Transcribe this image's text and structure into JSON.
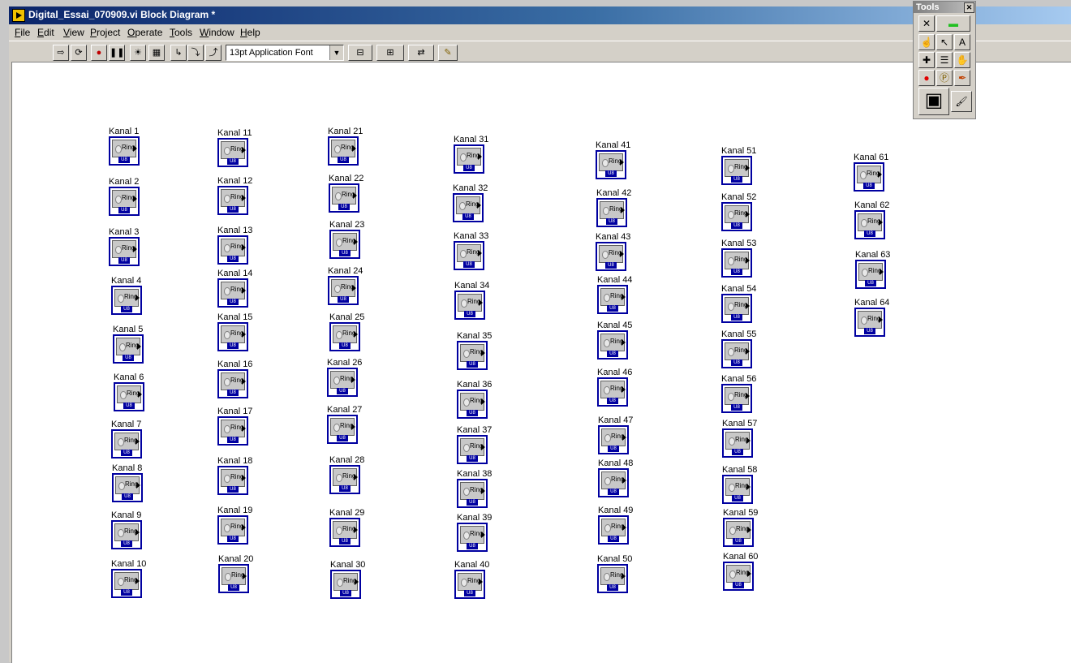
{
  "window": {
    "title": "Digital_Essai_070909.vi Block Diagram *",
    "menu": [
      "File",
      "Edit",
      "View",
      "Project",
      "Operate",
      "Tools",
      "Window",
      "Help"
    ]
  },
  "toolbar": {
    "font_select_value": "13pt Application Font",
    "buttons": [
      {
        "name": "run-arrow-icon",
        "glyph": "⇨"
      },
      {
        "name": "run-continuously-icon",
        "glyph": "⟳"
      },
      {
        "name": "abort-icon",
        "glyph": "●"
      },
      {
        "name": "pause-icon",
        "glyph": "❚❚"
      },
      {
        "name": "highlight-execution-icon",
        "glyph": "☀"
      },
      {
        "name": "retain-wire-values-icon",
        "glyph": "▦"
      },
      {
        "name": "step-into-icon",
        "glyph": "↳"
      },
      {
        "name": "step-over-icon",
        "glyph": "⤵"
      },
      {
        "name": "step-out-icon",
        "glyph": "⤴"
      },
      {
        "name": "align-objects-icon",
        "glyph": "⊟"
      },
      {
        "name": "distribute-objects-icon",
        "glyph": "⊞"
      },
      {
        "name": "reorder-icon",
        "glyph": "⇄"
      },
      {
        "name": "clean-up-diagram-icon",
        "glyph": "✎"
      }
    ]
  },
  "diagram": {
    "terminal_face_text": "Ring",
    "terminal_type_text": "U8",
    "nodes": [
      {
        "label": "Kanal 1"
      },
      {
        "label": "Kanal 2"
      },
      {
        "label": "Kanal 3"
      },
      {
        "label": "Kanal 4"
      },
      {
        "label": "Kanal 5"
      },
      {
        "label": "Kanal 6"
      },
      {
        "label": "Kanal 7"
      },
      {
        "label": "Kanal 8"
      },
      {
        "label": "Kanal 9"
      },
      {
        "label": "Kanal 10"
      },
      {
        "label": "Kanal 11"
      },
      {
        "label": "Kanal 12"
      },
      {
        "label": "Kanal 13"
      },
      {
        "label": "Kanal 14"
      },
      {
        "label": "Kanal 15"
      },
      {
        "label": "Kanal 16"
      },
      {
        "label": "Kanal 17"
      },
      {
        "label": "Kanal 18"
      },
      {
        "label": "Kanal 19"
      },
      {
        "label": "Kanal 20"
      },
      {
        "label": "Kanal 21"
      },
      {
        "label": "Kanal 22"
      },
      {
        "label": "Kanal 23"
      },
      {
        "label": "Kanal 24"
      },
      {
        "label": "Kanal 25"
      },
      {
        "label": "Kanal 26"
      },
      {
        "label": "Kanal 27"
      },
      {
        "label": "Kanal 28"
      },
      {
        "label": "Kanal 29"
      },
      {
        "label": "Kanal 30"
      },
      {
        "label": "Kanal 31"
      },
      {
        "label": "Kanal 32"
      },
      {
        "label": "Kanal 33"
      },
      {
        "label": "Kanal 34"
      },
      {
        "label": "Kanal 35"
      },
      {
        "label": "Kanal 36"
      },
      {
        "label": "Kanal 37"
      },
      {
        "label": "Kanal 38"
      },
      {
        "label": "Kanal 39"
      },
      {
        "label": "Kanal 40"
      },
      {
        "label": "Kanal 41"
      },
      {
        "label": "Kanal 42"
      },
      {
        "label": "Kanal 43"
      },
      {
        "label": "Kanal 44"
      },
      {
        "label": "Kanal 45"
      },
      {
        "label": "Kanal 46"
      },
      {
        "label": "Kanal 47"
      },
      {
        "label": "Kanal 48"
      },
      {
        "label": "Kanal 49"
      },
      {
        "label": "Kanal 50"
      },
      {
        "label": "Kanal 51"
      },
      {
        "label": "Kanal 52"
      },
      {
        "label": "Kanal 53"
      },
      {
        "label": "Kanal 54"
      },
      {
        "label": "Kanal 55"
      },
      {
        "label": "Kanal 56"
      },
      {
        "label": "Kanal 57"
      },
      {
        "label": "Kanal 58"
      },
      {
        "label": "Kanal 59"
      },
      {
        "label": "Kanal 60"
      },
      {
        "label": "Kanal 61"
      },
      {
        "label": "Kanal 62"
      },
      {
        "label": "Kanal 63"
      },
      {
        "label": "Kanal 64"
      }
    ]
  },
  "tools_palette": {
    "title": "Tools",
    "close_glyph": "✕",
    "tools": [
      {
        "name": "automatic-tool-selection-icon",
        "glyph": "✕"
      },
      {
        "name": "automatic-tool-indicator-icon",
        "glyph": "▬"
      },
      {
        "name": "operate-value-tool-icon",
        "glyph": "☝"
      },
      {
        "name": "position-size-select-tool-icon",
        "glyph": "↖"
      },
      {
        "name": "edit-text-tool-icon",
        "glyph": "A"
      },
      {
        "name": "connect-wire-tool-icon",
        "glyph": "✚"
      },
      {
        "name": "object-shortcut-menu-tool-icon",
        "glyph": "☰"
      },
      {
        "name": "scroll-window-tool-icon",
        "glyph": "✋"
      },
      {
        "name": "set-breakpoint-tool-icon",
        "glyph": "●"
      },
      {
        "name": "probe-data-tool-icon",
        "glyph": "Ⓟ"
      },
      {
        "name": "get-color-tool-icon",
        "glyph": "✒"
      },
      {
        "name": "set-color-tool-icon",
        "glyph": "▣"
      },
      {
        "name": "paintbrush-tool-icon",
        "glyph": "🖌"
      }
    ]
  }
}
